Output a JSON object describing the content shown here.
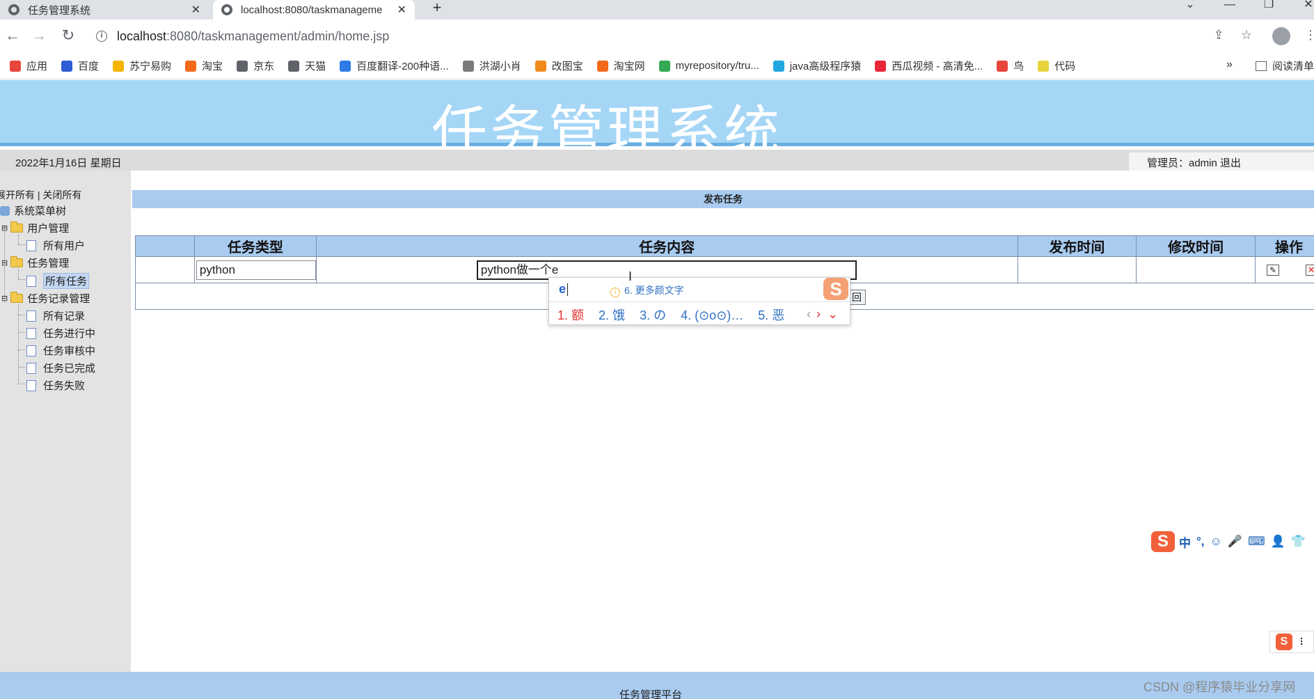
{
  "browser": {
    "tabs": [
      {
        "title": "任务管理系统",
        "active": false
      },
      {
        "title": "localhost:8080/taskmanageme",
        "active": true
      }
    ],
    "new_tab": "+",
    "url_host": "localhost",
    "url_rest": ":8080/taskmanagement/admin/home.jsp",
    "bookmarks": [
      {
        "label": "应用",
        "color": "#e8453c"
      },
      {
        "label": "百度",
        "color": "#2e5bd6"
      },
      {
        "label": "苏宁易购",
        "color": "#f5b400"
      },
      {
        "label": "淘宝",
        "color": "#f16a1b"
      },
      {
        "label": "京东",
        "color": "#5f6368"
      },
      {
        "label": "天猫",
        "color": "#5f6368"
      },
      {
        "label": "百度翻译-200种语...",
        "color": "#2e7be6"
      },
      {
        "label": "洪湖小肖",
        "color": "#7a7a7a"
      },
      {
        "label": "改图宝",
        "color": "#f08c1c"
      },
      {
        "label": "淘宝网",
        "color": "#f16a1b"
      },
      {
        "label": "myrepository/tru...",
        "color": "#34a853"
      },
      {
        "label": "java高级程序猿",
        "color": "#22a7e0"
      },
      {
        "label": "西瓜视频 - 高清免...",
        "color": "#e8263a"
      },
      {
        "label": "鸟",
        "color": "#e8453c"
      },
      {
        "label": "代码",
        "color": "#e8d33c"
      }
    ],
    "more": "»",
    "reading_list": "阅读清单"
  },
  "header": {
    "title": "任务管理系统",
    "date": "2022年1月16日 星期日",
    "admin_text": "管理员：admin 退出"
  },
  "sidebar": {
    "expand_collapse": "展开所有 | 关闭所有",
    "root": "系统菜单树",
    "groups": [
      {
        "label": "用户管理",
        "items": [
          "所有用户"
        ]
      },
      {
        "label": "任务管理",
        "items": [
          "所有任务"
        ]
      },
      {
        "label": "任务记录管理",
        "items": [
          "所有记录",
          "任务进行中",
          "任务审核中",
          "任务已完成",
          "任务失败"
        ]
      }
    ]
  },
  "main": {
    "section_title": "发布任务",
    "table": {
      "headers": [
        "",
        "任务类型",
        "任务内容",
        "发布时间",
        "修改时间",
        "操作"
      ],
      "row": {
        "type_value": "python",
        "content_value": "python做一个e",
        "publish_time": "",
        "modify_time": ""
      },
      "return_label": "回"
    }
  },
  "ime": {
    "input": "e",
    "hint": "6. 更多颜文字",
    "candidates": [
      "1. 额",
      "2. 饿",
      "3. の",
      "4. (⊙o⊙)…",
      "5. 恶"
    ],
    "nav_prev": "‹",
    "nav_next": "›",
    "nav_down": "⌄",
    "logo": "S"
  },
  "sogou_bar": {
    "logo": "S",
    "items": [
      "中",
      "°,",
      "☺",
      "🎤",
      "⌨",
      "👤",
      "👕"
    ]
  },
  "footer": {
    "text": "任务管理平台"
  },
  "watermark": "CSDN @程序猿毕业分享网"
}
